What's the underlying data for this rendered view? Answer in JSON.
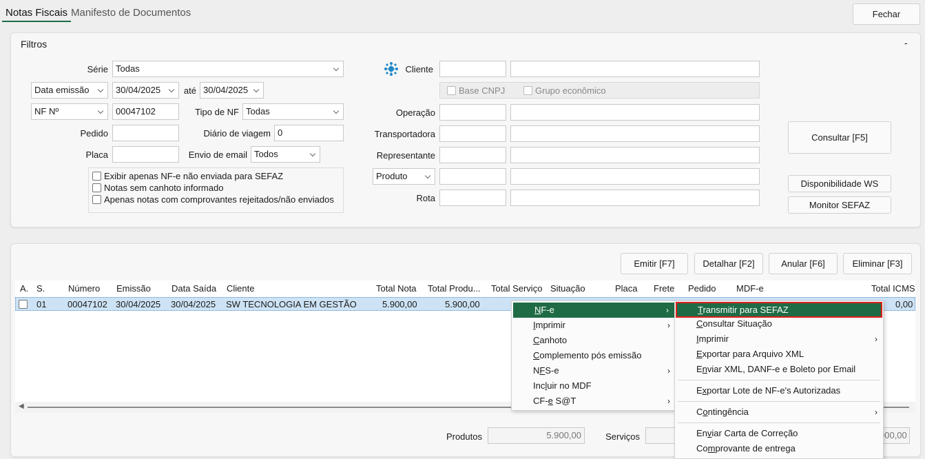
{
  "tabs": [
    {
      "label": "Notas Fiscais"
    },
    {
      "label": "Manifesto de Documentos"
    }
  ],
  "close_button": "Fechar",
  "filters": {
    "title": "Filtros",
    "collapse": "-",
    "serie_label": "Série",
    "serie_value": "Todas",
    "date_type": "Data emissão",
    "date_from": "30/04/2025",
    "ate_label": "até",
    "date_to": "30/04/2025",
    "nf_type": "NF Nº",
    "nf_value": "00047102",
    "tipo_nf_label": "Tipo de NF",
    "tipo_nf_value": "Todas",
    "pedido_label": "Pedido",
    "pedido_value": "",
    "diario_label": "Diário de viagem",
    "diario_value": "0",
    "placa_label": "Placa",
    "placa_value": "",
    "envio_label": "Envio de email",
    "envio_value": "Todos",
    "checks": [
      "Exibir apenas NF-e não enviada para SEFAZ",
      "Notas sem canhoto informado",
      "Apenas notas com comprovantes rejeitados/não enviados"
    ],
    "cliente_label": "Cliente",
    "base_cnpj": "Base CNPJ",
    "grupo_economico": "Grupo econômico",
    "operacao_label": "Operação",
    "transportadora_label": "Transportadora",
    "representante_label": "Representante",
    "produto_select": "Produto",
    "rota_label": "Rota",
    "consultar": "Consultar [F5]",
    "disponibilidade": "Disponibilidade WS",
    "monitor": "Monitor SEFAZ"
  },
  "actions": {
    "emitir": "Emitir [F7]",
    "detalhar": "Detalhar [F2]",
    "anular": "Anular [F6]",
    "eliminar": "Eliminar [F3]"
  },
  "grid": {
    "columns": {
      "a": "A.",
      "s": "S.",
      "numero": "Número",
      "emissao": "Emissão",
      "data_saida": "Data Saída",
      "cliente": "Cliente",
      "total_nota": "Total Nota",
      "total_produtos": "Total Produ...",
      "total_servico": "Total Serviço",
      "situacao": "Situação",
      "placa": "Placa",
      "frete": "Frete",
      "pedido": "Pedido",
      "mdfe": "MDF-e",
      "total_icms": "Total ICMS"
    },
    "row": {
      "s": "01",
      "numero": "00047102",
      "emissao": "30/04/2025",
      "data_saida": "30/04/2025",
      "cliente": "SW TECNOLOGIA EM GESTÃO",
      "total_nota": "5.900,00",
      "total_produtos": "5.900,00",
      "total_icms": "0,00"
    }
  },
  "footer": {
    "produtos_label": "Produtos",
    "produtos_value": "5.900,00",
    "servicos_label": "Serviços",
    "last_value": "900,00"
  },
  "context_menu": {
    "items": [
      {
        "pre": "",
        "key": "N",
        "post": "F-e",
        "submenu": true
      },
      {
        "pre": "",
        "key": "I",
        "post": "mprimir",
        "submenu": true
      },
      {
        "pre": "",
        "key": "C",
        "post": "anhoto",
        "submenu": false
      },
      {
        "pre": "",
        "key": "C",
        "post": "omplemento pós emissão",
        "submenu": false
      },
      {
        "pre": "N",
        "key": "F",
        "post": "S-e",
        "submenu": true
      },
      {
        "pre": "Inc",
        "key": "l",
        "post": "uir no MDF",
        "submenu": false
      },
      {
        "pre": "CF-",
        "key": "e",
        "post": " S@T",
        "submenu": true
      }
    ]
  },
  "submenu": {
    "items": [
      {
        "pre": "",
        "key": "T",
        "post": "ransmitir para SEFAZ"
      },
      {
        "pre": "",
        "key": "C",
        "post": "onsultar Situação"
      },
      {
        "pre": "",
        "key": "I",
        "post": "mprimir"
      },
      {
        "pre": "",
        "key": "E",
        "post": "xportar para Arquivo XML"
      },
      {
        "pre": "E",
        "key": "n",
        "post": "viar XML, DANF-e e Boleto por Email"
      },
      {
        "pre": "E",
        "key": "x",
        "post": "portar Lote de NF-e's Autorizadas"
      },
      {
        "pre": "C",
        "key": "o",
        "post": "ntingência"
      },
      {
        "pre": "En",
        "key": "v",
        "post": "iar Carta de Correção"
      },
      {
        "pre": "Co",
        "key": "m",
        "post": "provante de entrega"
      }
    ]
  },
  "colors": {
    "accent": "#1f6b45",
    "highlight_border": "#e0201c"
  },
  "icons": {
    "cliente_search": "network-icon"
  }
}
